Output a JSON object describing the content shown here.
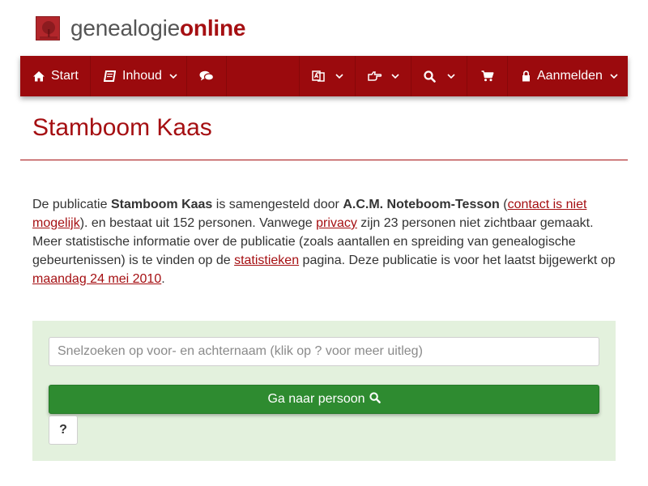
{
  "brand": {
    "name_part1": "genealogie",
    "name_part2": "online",
    "logo_icon": "family-tree-icon"
  },
  "nav": {
    "start_label": "Start",
    "contents_label": "Inhoud",
    "login_label": "Aanmelden",
    "icons": {
      "start": "home-icon",
      "contents": "book-icon",
      "chat": "comments-icon",
      "language": "translate-icon",
      "share": "hand-point-icon",
      "search": "search-icon",
      "cart": "shopping-cart-icon",
      "login": "lock-icon"
    },
    "color": "#9b0a0d"
  },
  "page": {
    "title": "Stamboom Kaas"
  },
  "intro": {
    "t1": "De publicatie ",
    "pub_name": "Stamboom Kaas",
    "t2": " is samengesteld door ",
    "author": "A.C.M. Noteboom-Tesson",
    "t3": " (",
    "contact_link": "contact is niet mogelijk",
    "t4": "). en bestaat uit 152 personen. Vanwege ",
    "privacy_link": "privacy",
    "t5": " zijn 23 personen niet zichtbaar gemaakt. Meer statistische informatie over de publicatie (zoals aantallen en spreiding van genealogische gebeurtenissen) is te vinden op de ",
    "stats_link": "statistieken",
    "t6": " pagina. Deze publicatie is voor het laatst bijgewerkt op ",
    "date_link": "maandag 24 mei 2010",
    "t7": "."
  },
  "search": {
    "placeholder": "Snelzoeken op voor- en achternaam (klik op ? voor meer uitleg)",
    "button_label": "Ga naar persoon",
    "help_label": "?"
  },
  "colors": {
    "accent": "#a50f12",
    "go_button": "#2e8b30",
    "panel_bg": "#e3f1dd"
  }
}
